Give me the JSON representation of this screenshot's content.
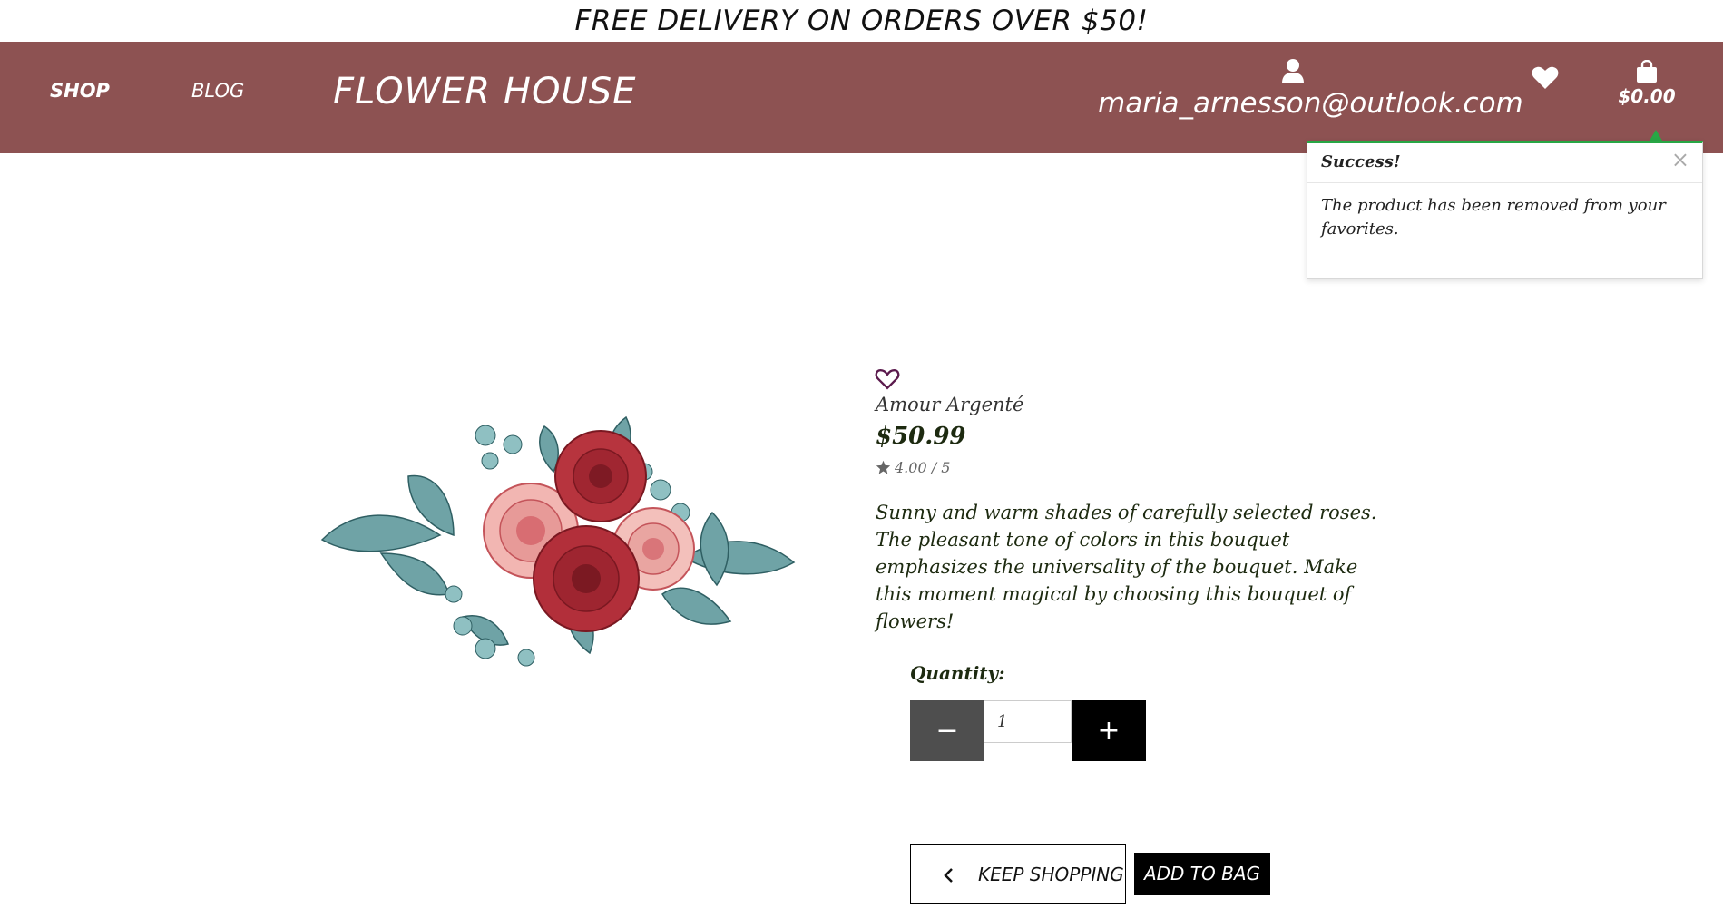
{
  "promo_banner": "FREE DELIVERY ON ORDERS OVER $50!",
  "nav": {
    "shop": "SHOP",
    "blog": "BLOG",
    "brand": "FLOWER HOUSE"
  },
  "account": {
    "email": "maria_arnesson@outlook.com",
    "icon": "user-icon"
  },
  "favorites": {
    "icon": "heart-icon"
  },
  "bag": {
    "total": "$0.00",
    "icon": "shopping-bag-icon"
  },
  "toast": {
    "title": "Success!",
    "message": "The product has been removed from your favorites.",
    "close": "×",
    "accent_color": "#28a745"
  },
  "product": {
    "name": "Amour Argenté",
    "price": "$50.99",
    "rating": "4.00",
    "rating_max": "/ 5",
    "description": "Sunny and warm shades of carefully selected roses. The pleasant tone of colors in this bouquet emphasizes the universality of the bouquet. Make this moment magical by choosing this bouquet of flowers!",
    "image_icon": "rose-bouquet-illustration"
  },
  "quantity": {
    "label": "Quantity:",
    "value": "1",
    "minus": "−",
    "plus": "+"
  },
  "actions": {
    "keep_shopping": "KEEP SHOPPING",
    "add_to_bag": "ADD TO BAG"
  },
  "colors": {
    "navbar": "#8d5252",
    "text_dark": "#1d2a10",
    "fav_outline": "#5b1a4d"
  }
}
